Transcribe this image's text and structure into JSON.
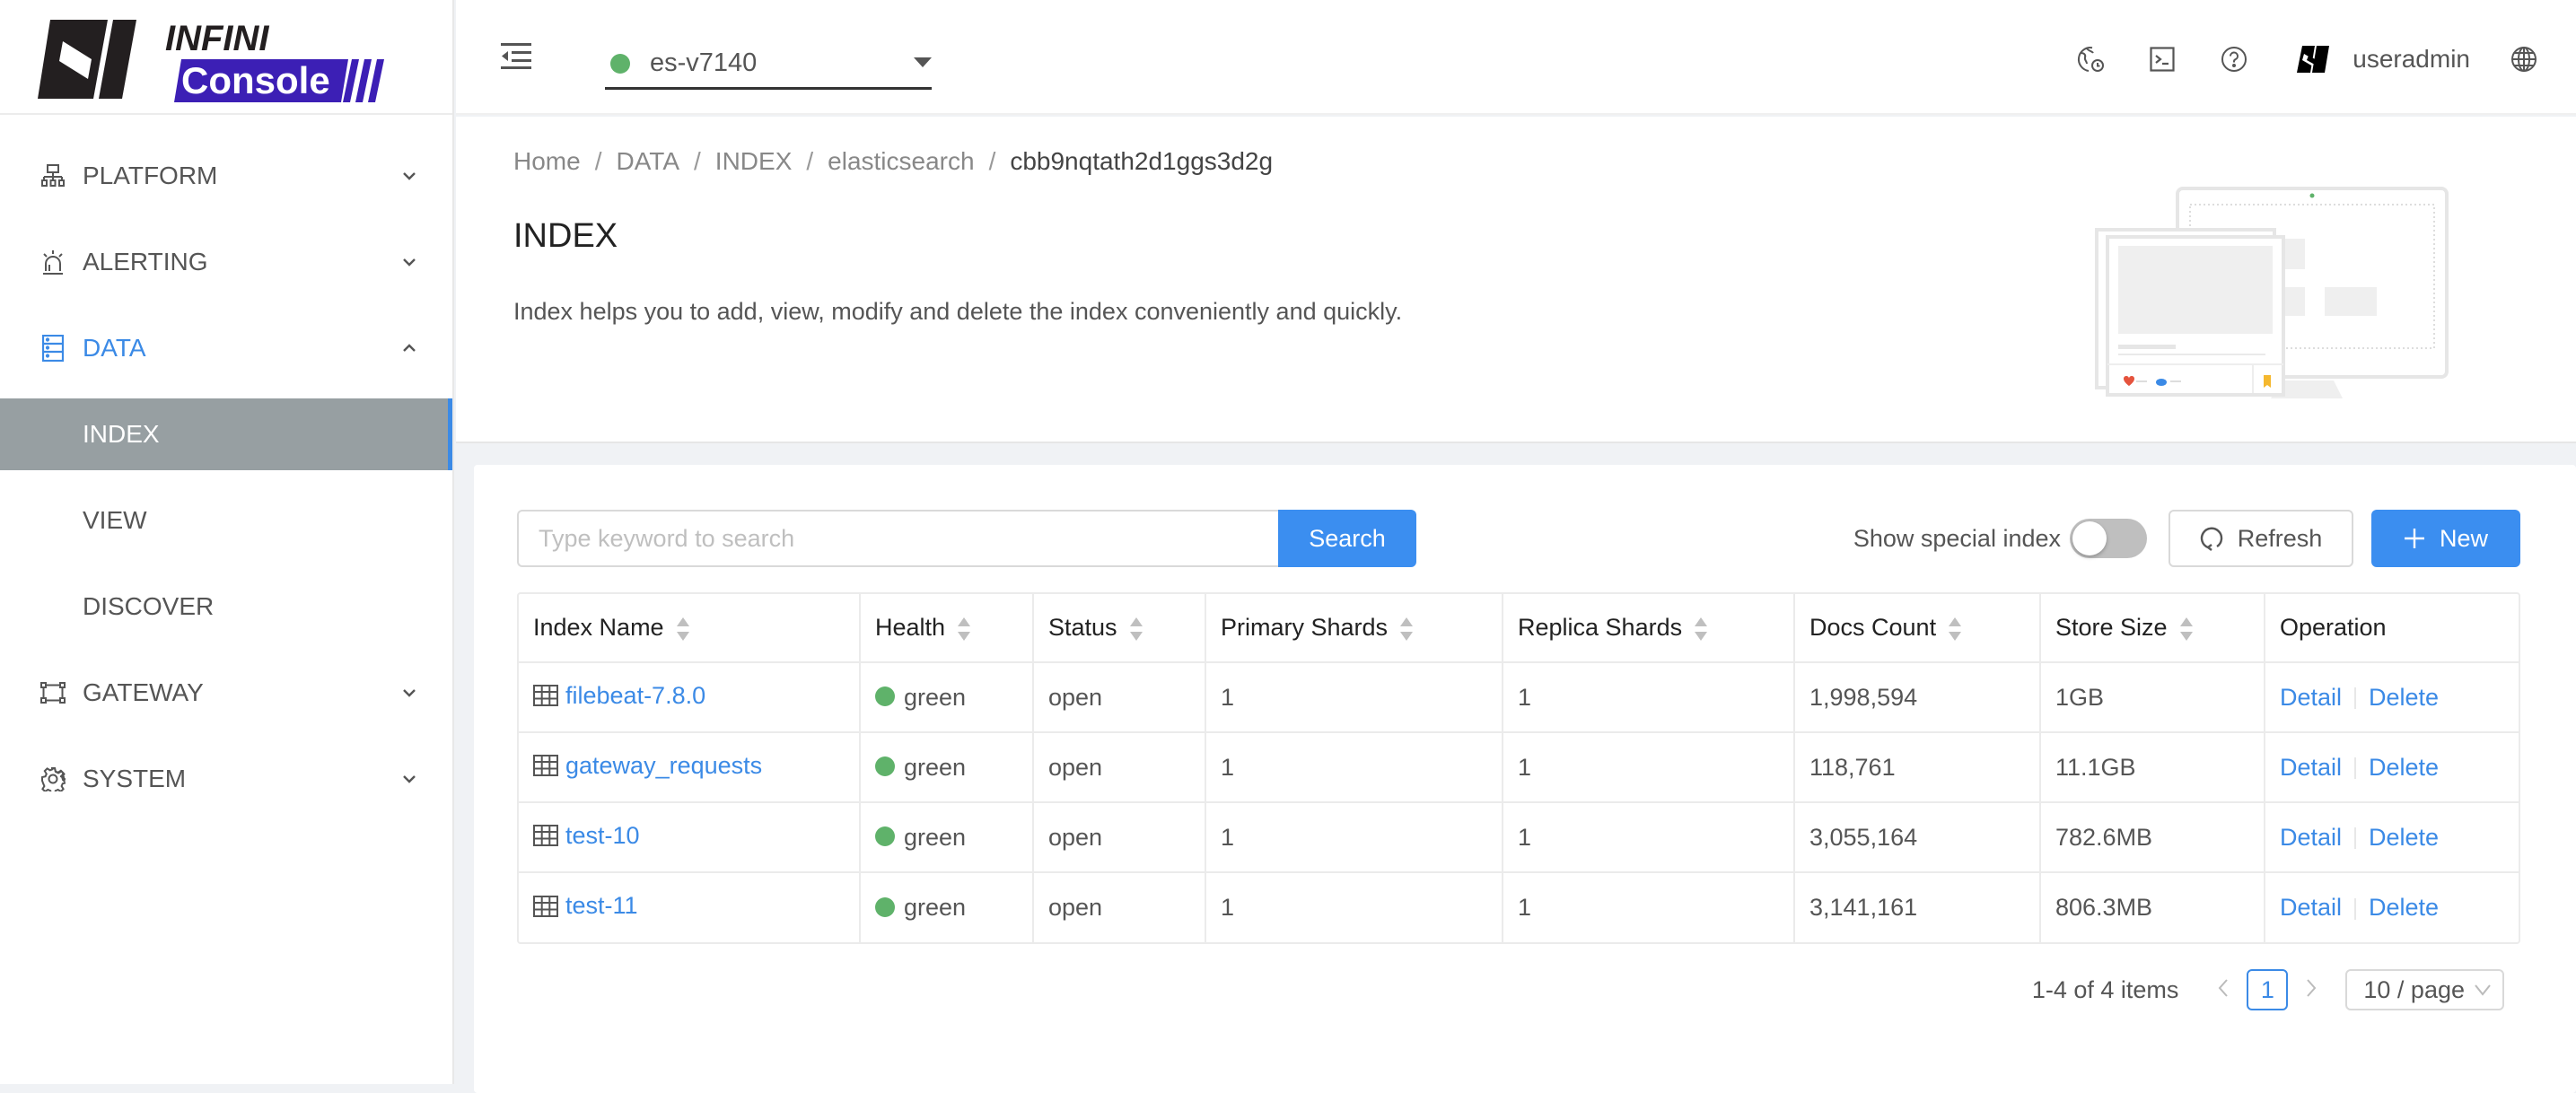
{
  "app": {
    "logo_top": "INFINI",
    "logo_bottom": "Console",
    "brand_color": "#3c1fb5"
  },
  "sidebar": {
    "items": [
      {
        "label": "PLATFORM",
        "icon": "sitemap-icon",
        "state": "collapsed"
      },
      {
        "label": "ALERTING",
        "icon": "alarm-icon",
        "state": "collapsed"
      },
      {
        "label": "DATA",
        "icon": "database-icon",
        "state": "expanded",
        "children": [
          {
            "label": "INDEX",
            "active": true
          },
          {
            "label": "VIEW",
            "active": false
          },
          {
            "label": "DISCOVER",
            "active": false
          }
        ]
      },
      {
        "label": "GATEWAY",
        "icon": "gateway-icon",
        "state": "collapsed"
      },
      {
        "label": "SYSTEM",
        "icon": "gear-icon",
        "state": "collapsed"
      }
    ]
  },
  "header": {
    "cluster": {
      "name": "es-v7140",
      "status_color": "#5fb26a"
    },
    "icons": [
      "timezone-globe-icon",
      "terminal-icon",
      "help-icon"
    ],
    "user": {
      "name": "useradmin"
    },
    "language_icon": "globe-icon"
  },
  "page": {
    "breadcrumb": [
      "Home",
      "DATA",
      "INDEX",
      "elasticsearch",
      "cbb9nqtath2d1ggs3d2g"
    ],
    "title": "INDEX",
    "description": "Index helps you to add, view, modify and delete the index conveniently and quickly."
  },
  "toolbar": {
    "search_placeholder": "Type keyword to search",
    "search_value": "",
    "search_label": "Search",
    "special_index_label": "Show special index",
    "special_index_on": false,
    "refresh_label": "Refresh",
    "new_label": "New"
  },
  "table": {
    "columns": [
      "Index Name",
      "Health",
      "Status",
      "Primary Shards",
      "Replica Shards",
      "Docs Count",
      "Store Size",
      "Operation"
    ],
    "rows": [
      {
        "name": "filebeat-7.8.0",
        "health": "green",
        "status": "open",
        "primary": "1",
        "replica": "1",
        "docs": "1,998,594",
        "size": "1GB"
      },
      {
        "name": "gateway_requests",
        "health": "green",
        "status": "open",
        "primary": "1",
        "replica": "1",
        "docs": "118,761",
        "size": "11.1GB"
      },
      {
        "name": "test-10",
        "health": "green",
        "status": "open",
        "primary": "1",
        "replica": "1",
        "docs": "3,055,164",
        "size": "782.6MB"
      },
      {
        "name": "test-11",
        "health": "green",
        "status": "open",
        "primary": "1",
        "replica": "1",
        "docs": "3,141,161",
        "size": "806.3MB"
      }
    ],
    "actions": {
      "detail": "Detail",
      "delete": "Delete"
    }
  },
  "pagination": {
    "total_text": "1-4 of 4 items",
    "current_page": "1",
    "page_size": "10 / page"
  }
}
